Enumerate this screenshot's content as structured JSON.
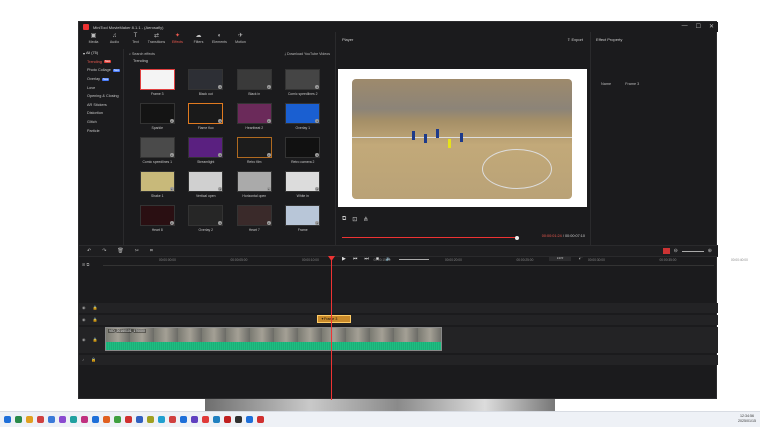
{
  "app": {
    "title": "MiniTool MovieMaker 8.1.1 - (Aerosafly)",
    "window_buttons": [
      "—",
      "☐",
      "✕"
    ]
  },
  "toolbar": [
    {
      "label": "Media",
      "icon": "media-icon",
      "glyph": "▣"
    },
    {
      "label": "Audio",
      "icon": "audio-icon",
      "glyph": "♫"
    },
    {
      "label": "Text",
      "icon": "text-icon",
      "glyph": "T"
    },
    {
      "label": "Transitions",
      "icon": "transitions-icon",
      "glyph": "⇄"
    },
    {
      "label": "Effects",
      "icon": "effects-icon",
      "glyph": "✦",
      "active": true
    },
    {
      "label": "Filters",
      "icon": "filters-icon",
      "glyph": "☁"
    },
    {
      "label": "Elements",
      "icon": "elements-icon",
      "glyph": "◐"
    },
    {
      "label": "Motion",
      "icon": "motion-icon",
      "glyph": "✈"
    }
  ],
  "categories": {
    "all": "All (75)",
    "items": [
      {
        "label": "Trending",
        "badge": "New",
        "selected": true
      },
      {
        "label": "Photo Collage",
        "badge": "New"
      },
      {
        "label": "Overlay",
        "badge": "New"
      },
      {
        "label": "Love"
      },
      {
        "label": "Opening & Closing"
      },
      {
        "label": "AR Stickers"
      },
      {
        "label": "Distortion"
      },
      {
        "label": "Glitch"
      },
      {
        "label": "Particle"
      }
    ]
  },
  "library": {
    "search_label": "Search effects",
    "download_label": "Download YouTube Videos",
    "section": "Trending",
    "effects": [
      {
        "name": "Frame 3",
        "color": "#f4f4f4",
        "border": "#e04040"
      },
      {
        "name": "Black out",
        "color": "#2d2f35"
      },
      {
        "name": "Black in",
        "color": "#3a3a3a"
      },
      {
        "name": "Comic speedlines 2",
        "color": "#454545"
      },
      {
        "name": "Sparkle",
        "color": "#141414"
      },
      {
        "name": "Flame fluo",
        "color": "#1a1a1a",
        "border": "#e07a20"
      },
      {
        "name": "Heartbeat 2",
        "color": "#6b2a5a"
      },
      {
        "name": "Overlay 1",
        "color": "#1a5fd1"
      },
      {
        "name": "Comic speedlines 1",
        "color": "#4a4a4a"
      },
      {
        "name": "Streamlight",
        "color": "#5a2080"
      },
      {
        "name": "Retro film",
        "color": "#1c1c1c",
        "border": "#b06a20"
      },
      {
        "name": "Retro camera 2",
        "color": "#111111"
      },
      {
        "name": "Shake 1",
        "color": "#c8b97a"
      },
      {
        "name": "Vertical open",
        "color": "#d0d0d0"
      },
      {
        "name": "Horizontal open",
        "color": "#aaaaaa"
      },
      {
        "name": "White in",
        "color": "#dcdcdc"
      },
      {
        "name": "Heart 8",
        "color": "#2a0f12"
      },
      {
        "name": "Overlay 2",
        "color": "#262626"
      },
      {
        "name": "Heart 7",
        "color": "#3a2a2a"
      },
      {
        "name": "Frame",
        "color": "#b8c6d8"
      }
    ]
  },
  "player": {
    "title": "Player",
    "export_label": "Export",
    "current_time": "00:00:01:24",
    "total_time": "00:00:07:10",
    "progress": 1.0,
    "aspect": "16:9",
    "icons": [
      "snapshot-icon",
      "crop-icon",
      "share-icon"
    ]
  },
  "property": {
    "title": "Effect Property",
    "name_label": "Name",
    "name_value": "Frame 3"
  },
  "timeline": {
    "ruler": [
      "00:00:00:00",
      "00:00:05:00",
      "00:00:10:00",
      "00:00:15:00",
      "00:00:20:00",
      "00:00:25:00",
      "00:00:30:00",
      "00:00:35:00",
      "00:00:40:00"
    ],
    "effect_clip": "Frame 3",
    "video_clip": "VID_20160101_170000"
  },
  "taskbar": {
    "time": "12:34:56",
    "date": "2025/01/15"
  }
}
